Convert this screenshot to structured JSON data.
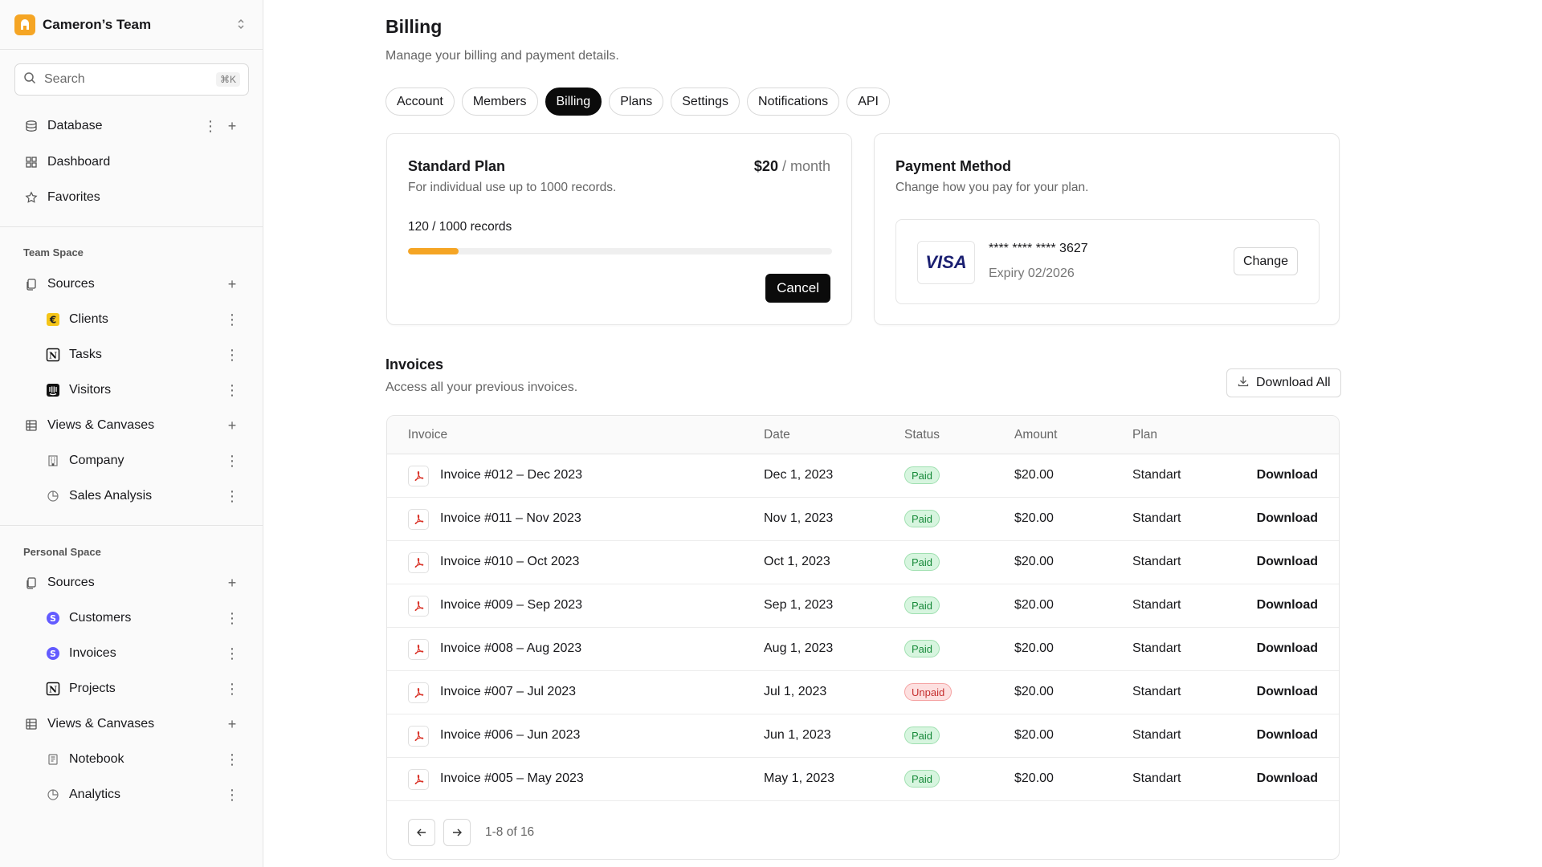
{
  "sidebar": {
    "team_name": "Cameron’s Team",
    "search_placeholder": "Search",
    "search_shortcut": "⌘K",
    "top_items": [
      {
        "label": "Database",
        "icon": "database-icon"
      },
      {
        "label": "Dashboard",
        "icon": "dashboard-icon"
      },
      {
        "label": "Favorites",
        "icon": "star-icon"
      }
    ],
    "team_space": {
      "title": "Team Space",
      "sources_label": "Sources",
      "sources": [
        {
          "label": "Clients",
          "icon": "coin-app-icon"
        },
        {
          "label": "Tasks",
          "icon": "notion-icon"
        },
        {
          "label": "Visitors",
          "icon": "intercom-icon"
        }
      ],
      "views_label": "Views & Canvases",
      "views": [
        {
          "label": "Company",
          "icon": "building-icon"
        },
        {
          "label": "Sales Analysis",
          "icon": "pie-chart-icon"
        }
      ]
    },
    "personal_space": {
      "title": "Personal Space",
      "sources_label": "Sources",
      "sources": [
        {
          "label": "Customers",
          "icon": "stripe-icon"
        },
        {
          "label": "Invoices",
          "icon": "stripe-icon"
        },
        {
          "label": "Projects",
          "icon": "notion-icon"
        }
      ],
      "views_label": "Views & Canvases",
      "views": [
        {
          "label": "Notebook",
          "icon": "notebook-icon"
        },
        {
          "label": "Analytics",
          "icon": "pie-chart-icon"
        }
      ]
    }
  },
  "main": {
    "title": "Billing",
    "subtitle": "Manage your billing and payment details.",
    "tabs": [
      "Account",
      "Members",
      "Billing",
      "Plans",
      "Settings",
      "Notifications",
      "API"
    ],
    "active_tab": "Billing",
    "plan": {
      "name": "Standard Plan",
      "price": "$20",
      "period": " / month",
      "description": "For individual use up to 1000 records.",
      "records_text": "120 / 1000 records",
      "records_used": 120,
      "records_limit": 1000,
      "cancel_label": "Cancel",
      "accent_color": "#f5a524"
    },
    "payment": {
      "title": "Payment Method",
      "description": "Change how you pay for your plan.",
      "card_brand": "VISA",
      "card_number": "**** **** **** 3627",
      "expiry": "Expiry 02/2026",
      "change_label": "Change"
    },
    "invoices": {
      "title": "Invoices",
      "subtitle": "Access all your previous invoices.",
      "download_all_label": "Download All",
      "columns": [
        "Invoice",
        "Date",
        "Status",
        "Amount",
        "Plan"
      ],
      "rows": [
        {
          "name": "Invoice #012 – Dec 2023",
          "date": "Dec 1, 2023",
          "status": "Paid",
          "amount": "$20.00",
          "plan": "Standart",
          "action": "Download"
        },
        {
          "name": "Invoice #011 – Nov 2023",
          "date": "Nov 1, 2023",
          "status": "Paid",
          "amount": "$20.00",
          "plan": "Standart",
          "action": "Download"
        },
        {
          "name": "Invoice #010 – Oct 2023",
          "date": "Oct 1, 2023",
          "status": "Paid",
          "amount": "$20.00",
          "plan": "Standart",
          "action": "Download"
        },
        {
          "name": "Invoice #009 – Sep 2023",
          "date": "Sep 1, 2023",
          "status": "Paid",
          "amount": "$20.00",
          "plan": "Standart",
          "action": "Download"
        },
        {
          "name": "Invoice #008 – Aug 2023",
          "date": "Aug 1, 2023",
          "status": "Paid",
          "amount": "$20.00",
          "plan": "Standart",
          "action": "Download"
        },
        {
          "name": "Invoice #007 – Jul 2023",
          "date": "Jul 1, 2023",
          "status": "Unpaid",
          "amount": "$20.00",
          "plan": "Standart",
          "action": "Download"
        },
        {
          "name": "Invoice #006 – Jun 2023",
          "date": "Jun 1, 2023",
          "status": "Paid",
          "amount": "$20.00",
          "plan": "Standart",
          "action": "Download"
        },
        {
          "name": "Invoice #005 – May 2023",
          "date": "May 1, 2023",
          "status": "Paid",
          "amount": "$20.00",
          "plan": "Standart",
          "action": "Download"
        }
      ],
      "pagination": "1-8 of 16"
    }
  }
}
